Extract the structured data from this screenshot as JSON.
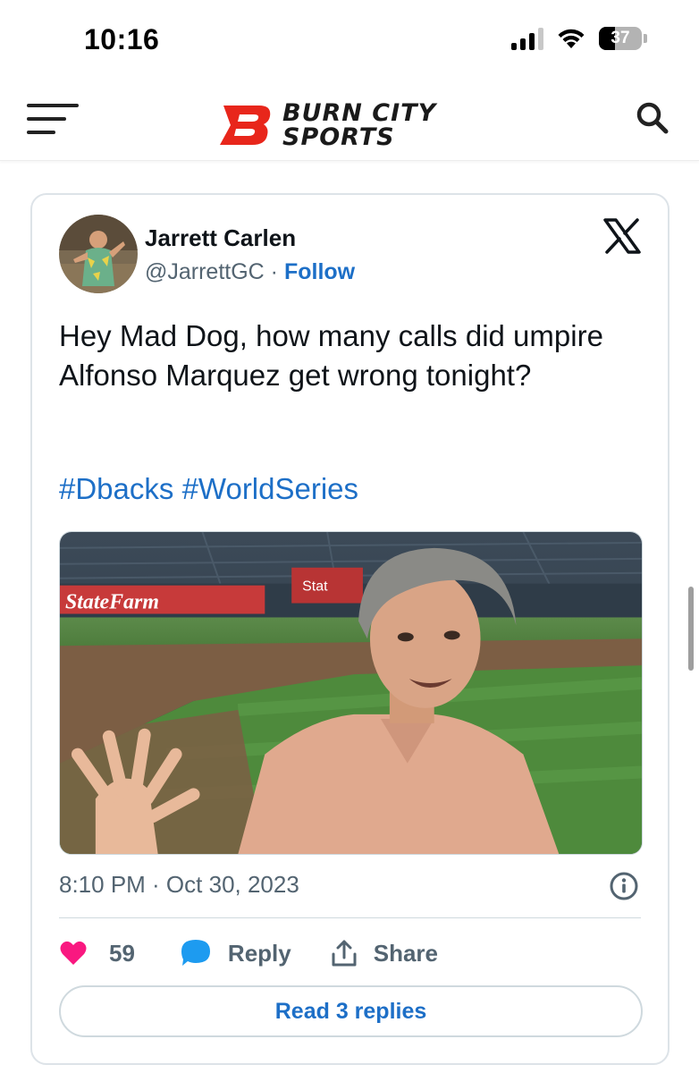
{
  "status_bar": {
    "time": "10:16",
    "battery": "37"
  },
  "site": {
    "logo_line1": "BURN CITY",
    "logo_line2": "SPORTS",
    "brand_color": "#e8261b"
  },
  "tweet": {
    "author_name": "Jarrett Carlen",
    "author_handle": "@JarrettGC",
    "separator": " · ",
    "follow_label": "Follow",
    "text": "Hey Mad Dog, how many calls did umpire Alfonso Marquez get wrong tonight?",
    "hashtags": [
      "#Dbacks",
      "#WorldSeries"
    ],
    "media_signs": [
      "StateFarm",
      "Stat"
    ],
    "timestamp": "8:10 PM · Oct 30, 2023",
    "like_count": "59",
    "reply_label": "Reply",
    "share_label": "Share",
    "read_replies_label": "Read 3 replies",
    "like_color": "#f91880",
    "link_color": "#1d6fc7"
  },
  "icons": {
    "menu": "menu-icon",
    "search": "search-icon",
    "platform": "x-logo-icon",
    "like": "heart-icon",
    "reply": "speech-bubble-icon",
    "share": "share-icon",
    "info": "info-icon"
  }
}
